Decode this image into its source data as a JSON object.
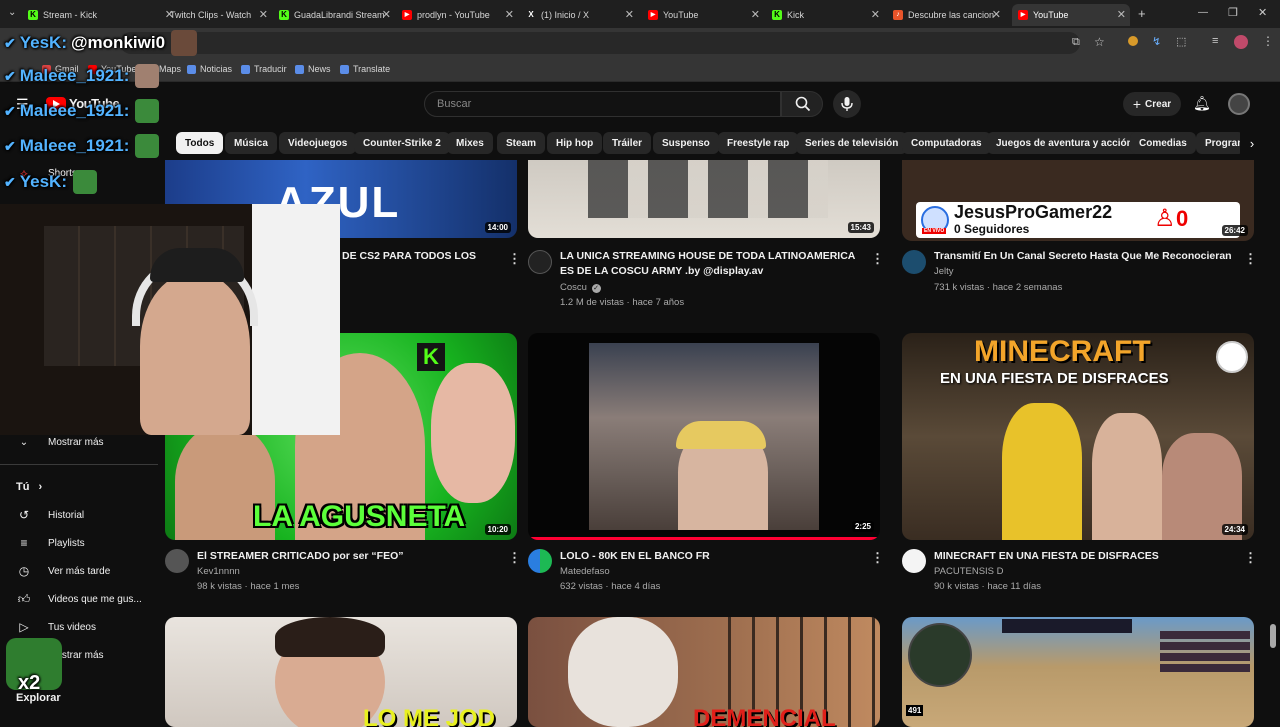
{
  "browser": {
    "tabs": [
      {
        "label": "Stream - Kick",
        "color": "#53fc18",
        "icon": "K"
      },
      {
        "label": "Twitch Clips - Watch",
        "color": "#9146ff",
        "icon": ""
      },
      {
        "label": "GuadaLibrandi Stream",
        "color": "#53fc18",
        "icon": "K"
      },
      {
        "label": "prodlyn - YouTube",
        "color": "#ff0000",
        "icon": "▶"
      },
      {
        "label": "(1) Inicio / X",
        "color": "#000000",
        "icon": "X"
      },
      {
        "label": "YouTube",
        "color": "#ff0000",
        "icon": "▶"
      },
      {
        "label": "Kick",
        "color": "#53fc18",
        "icon": "K"
      },
      {
        "label": "Descubre las cancion",
        "color": "#e8542a",
        "icon": "♪"
      },
      {
        "label": "YouTube",
        "color": "#ff0000",
        "icon": "▶"
      }
    ],
    "new_tab": "+",
    "window_controls": {
      "minimize": "—",
      "restore": "❐",
      "close": "✕"
    },
    "bookmarks": [
      "Gmail",
      "YouTube",
      "Maps",
      "Noticias",
      "Traducir",
      "News",
      "Translate"
    ]
  },
  "youtube": {
    "logo_text": "YouTube",
    "search_placeholder": "Buscar",
    "create_label": "Crear",
    "chips": [
      "Todos",
      "Música",
      "Videojuegos",
      "Counter-Strike 2",
      "Mixes",
      "Steam",
      "Hip hop",
      "Tráiler",
      "Suspenso",
      "Freestyle rap",
      "Series de televisión",
      "Computadoras",
      "Juegos de aventura y acción",
      "Comedias",
      "Program"
    ],
    "sidebar": {
      "shorts": "Shorts",
      "mostrar_mas": "Mostrar más",
      "tu_heading": "Tú",
      "items": [
        {
          "label": "Historial",
          "icon": "history-icon"
        },
        {
          "label": "Playlists",
          "icon": "playlist-icon"
        },
        {
          "label": "Ver más tarde",
          "icon": "clock-icon"
        },
        {
          "label": "Videos que me gus...",
          "icon": "thumbs-up-icon"
        },
        {
          "label": "Tus videos",
          "icon": "video-icon"
        }
      ],
      "mostrar_mas_2": "Mostrar más",
      "explorar": "Explorar"
    },
    "videos_row1": [
      {
        "title_partial": "DE CS2 PARA TODOS LOS",
        "duration": "14:00",
        "thumb_text": "AZUL"
      },
      {
        "title": "LA UNICA STREAMING HOUSE DE TODA LATINOAMERICA ES DE LA COSCU ARMY .by @display.av",
        "channel": "Coscu",
        "meta": "1.2 M de vistas · hace 7 años",
        "duration": "15:43"
      },
      {
        "title": "Transmití En Un Canal Secreto Hasta Que Me Reconocieran",
        "channel": "Jelty",
        "meta": "731 k vistas · hace 2 semanas",
        "duration": "26:42",
        "thumb_name": "JesusProGamer22",
        "thumb_followers": "0 Seguidores",
        "thumb_count": "0",
        "thumb_badge": "EN VIVO"
      }
    ],
    "videos_row2": [
      {
        "title": "El STREAMER CRITICADO por ser “FEO”",
        "channel": "Kev1nnnn",
        "meta": "98 k vistas · hace 1 mes",
        "duration": "10:20",
        "thumb_text": "LA AGUSNETA",
        "thumb_badge": "K"
      },
      {
        "title": "LOLO - 80K EN EL BANCO FR",
        "channel": "Matedefaso",
        "meta": "632 vistas · hace 4 días",
        "duration": "2:25"
      },
      {
        "title": "MINECRAFT EN UNA FIESTA DE DISFRACES",
        "channel": "PACUTENSIS D",
        "meta": "90 k vistas · hace 11 días",
        "duration": "24:34",
        "thumb_line1": "MINECRAFT",
        "thumb_line2": "EN UNA FIESTA DE DISFRACES"
      }
    ],
    "videos_row3": [
      {
        "thumb_text": "LO ME JOD"
      },
      {
        "thumb_text": "DEMENCIAL"
      },
      {
        "thumb_corner": "491"
      }
    ]
  },
  "overlay": {
    "chat": [
      {
        "user": "YesK:",
        "message": "@monkiwi0"
      },
      {
        "user": "Maleee_1921:",
        "message": ""
      },
      {
        "user": "Maleee_1921:",
        "message": ""
      },
      {
        "user": "Maleee_1921:",
        "message": ""
      },
      {
        "user": "YesK:",
        "message": ""
      }
    ],
    "multiplier": "x2"
  }
}
